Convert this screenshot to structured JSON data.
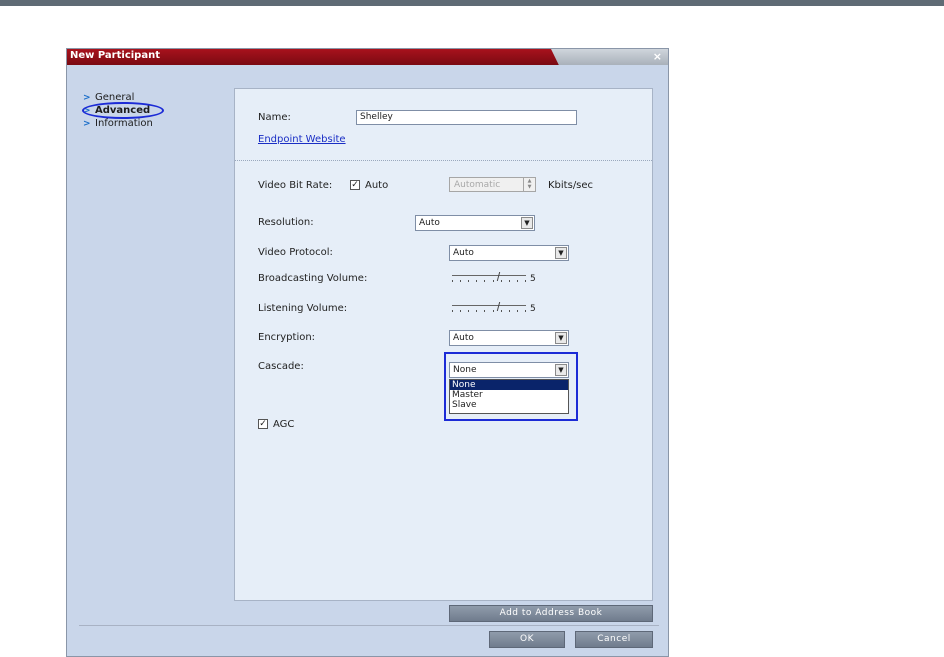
{
  "window": {
    "title": "New Participant",
    "close_glyph": "×"
  },
  "nav": {
    "items": [
      {
        "label": "General",
        "icon": "chevron-right-icon"
      },
      {
        "label": "Advanced",
        "icon": "chevron-right-icon",
        "active": true
      },
      {
        "label": "Information",
        "icon": "chevron-right-icon"
      }
    ]
  },
  "form": {
    "name_label": "Name:",
    "name_value": "Shelley",
    "endpoint_link": "Endpoint Website",
    "video_bit_rate_label": "Video Bit Rate:",
    "auto_label": "Auto",
    "auto_checked": true,
    "bit_rate_value": "Automatic",
    "bit_rate_unit": "Kbits/sec",
    "resolution_label": "Resolution:",
    "resolution_value": "Auto",
    "video_protocol_label": "Video Protocol:",
    "video_protocol_value": "Auto",
    "broadcasting_volume_label": "Broadcasting Volume:",
    "broadcasting_volume_value": "5",
    "listening_volume_label": "Listening Volume:",
    "listening_volume_value": "5",
    "encryption_label": "Encryption:",
    "encryption_value": "Auto",
    "cascade_label": "Cascade:",
    "cascade_value": "None",
    "cascade_options": [
      "None",
      "Master",
      "Slave"
    ],
    "cascade_selected": "None",
    "agc_label": "AGC",
    "agc_checked": true
  },
  "buttons": {
    "add_to_address_book": "Add to Address Book",
    "ok": "OK",
    "cancel": "Cancel"
  },
  "colors": {
    "titlebar": "#a8121d",
    "dialog_bg": "#c9d6ea",
    "panel_bg": "#e6eef8",
    "highlight": "#1c2bd6",
    "link": "#1a2ec5",
    "button": "#7f8b9c"
  }
}
